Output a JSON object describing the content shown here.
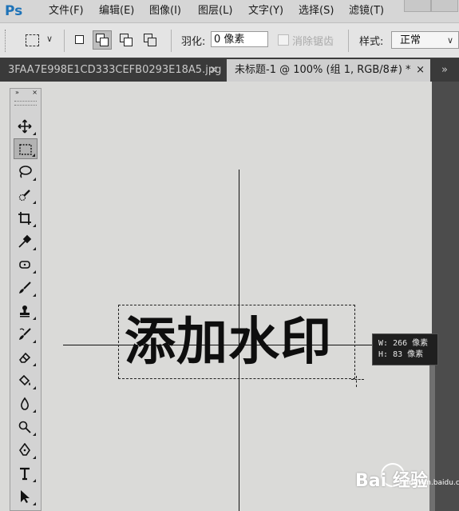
{
  "app": {
    "logo": "Ps"
  },
  "menu": {
    "items": [
      "文件(F)",
      "编辑(E)",
      "图像(I)",
      "图层(L)",
      "文字(Y)",
      "选择(S)",
      "滤镜(T)"
    ]
  },
  "options": {
    "feather_label": "羽化:",
    "feather_value": "0 像素",
    "antialias_label": "消除锯齿",
    "style_label": "样式:",
    "style_value": "正常"
  },
  "tabs": [
    {
      "label": "3FAA7E998E1CD333CEFB0293E18A5.jpg",
      "close": "×",
      "active": false
    },
    {
      "label": "未标题-1 @ 100% (组 1, RGB/8#) *",
      "close": "×",
      "active": true
    }
  ],
  "tab_overflow": "»",
  "toolbar": {
    "header": "»",
    "close": "×",
    "tools": [
      "move-icon",
      "rectangular-marquee-icon",
      "lasso-icon",
      "quick-selection-icon",
      "crop-icon",
      "eyedropper-icon",
      "spot-healing-icon",
      "brush-icon",
      "clone-stamp-icon",
      "history-brush-icon",
      "eraser-icon",
      "paint-bucket-icon",
      "blur-icon",
      "dodge-icon",
      "pen-icon",
      "type-icon",
      "path-selection-icon"
    ]
  },
  "canvas": {
    "text": "添加水印"
  },
  "dimension_tip": {
    "w_label": "W:",
    "w_value": "266 像素",
    "h_label": "H:",
    "h_value": "83 像素"
  },
  "watermark": {
    "brand": "Bai  经验",
    "sub": "jingyan.baidu.com"
  }
}
